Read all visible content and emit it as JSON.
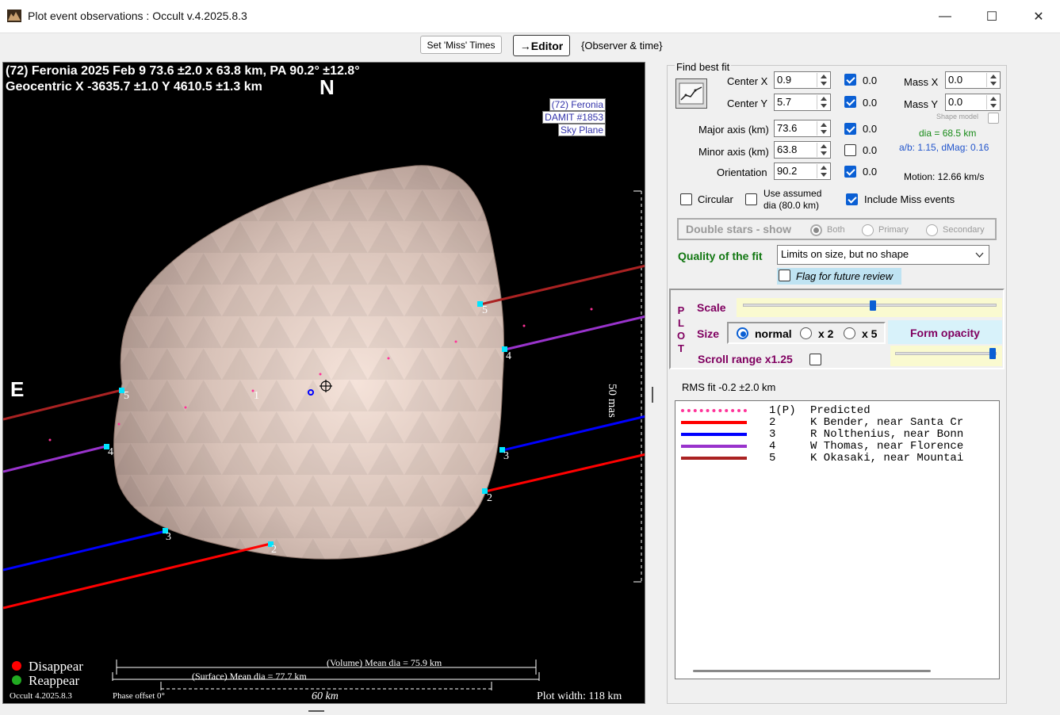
{
  "window": {
    "title": "Plot event observations : Occult v.4.2025.8.3",
    "minimize": "—",
    "maximize": "☐",
    "close": "✕"
  },
  "toolbar": {
    "set_miss_label": "Set 'Miss' Times",
    "editor_label": "→Editor",
    "observer_time_label": "{Observer & time}"
  },
  "plot": {
    "header_line1": "(72) Feronia  2025 Feb 9   73.6 ±2.0 x 63.8 km,  PA 90.2° ±12.8°",
    "header_line2": "Geocentric  X  -3635.7 ±1.0  Y 4610.5 ±1.3 km",
    "north": "N",
    "east": "E",
    "model_box": [
      "(72) Feronia",
      "DAMIT #1853",
      "Sky Plane"
    ],
    "scale_label": "50 mas",
    "legend": {
      "disappear": "Disappear",
      "reappear": "Reappear",
      "disappear_color": "#ff0000",
      "reappear_color": "#22aa22"
    },
    "volume_dia": "(Volume) Mean dia = 75.9 km",
    "surface_dia": "(Surface) Mean dia = 77.7 km",
    "phase_offset": "Phase offset 0°",
    "scale_bar": "60 km",
    "plot_width": "Plot width: 118 km",
    "version": "Occult 4.2025.8.3",
    "chord_labels": {
      "predicted": "1",
      "c2": "2",
      "c3": "3",
      "c4": "4",
      "c5": "5"
    }
  },
  "fit": {
    "group_title": "Find best fit",
    "center_x": {
      "label": "Center X",
      "value": "0.9",
      "checked": true,
      "delta": "0.0"
    },
    "center_y": {
      "label": "Center Y",
      "value": "5.7",
      "checked": true,
      "delta": "0.0"
    },
    "major_axis": {
      "label": "Major axis (km)",
      "value": "73.6",
      "checked": true,
      "delta": "0.0"
    },
    "minor_axis": {
      "label": "Minor axis (km)",
      "value": "63.8",
      "checked": false,
      "delta": "0.0"
    },
    "orientation": {
      "label": "Orientation",
      "value": "90.2",
      "checked": true,
      "delta": "0.0"
    },
    "mass_x": {
      "label": "Mass X",
      "value": "0.0"
    },
    "mass_y": {
      "label": "Mass Y",
      "value": "0.0"
    },
    "shape_model_label": "Shape model",
    "dia": "dia = 68.5 km",
    "ab": "a/b: 1.15, dMag: 0.16",
    "motion": "Motion: 12.66 km/s",
    "circular_label": "Circular",
    "use_assumed_label_1": "Use assumed",
    "use_assumed_label_2": "dia (80.0 km)",
    "include_miss_label": "Include Miss events",
    "double_stars_label": "Double stars - show",
    "both_label": "Both",
    "primary_label": "Primary",
    "secondary_label": "Secondary",
    "quality_label": "Quality of the fit",
    "quality_value": "Limits on size, but no shape",
    "flag_label": "Flag for future review"
  },
  "plot_opts": {
    "plot_letters": [
      "P",
      "L",
      "O",
      "T"
    ],
    "scale_label": "Scale",
    "size_label": "Size",
    "normal_label": "normal",
    "x2_label": "x 2",
    "x5_label": "x 5",
    "form_opacity_label": "Form opacity",
    "scroll_range_label": "Scroll range x1.25"
  },
  "rms": "RMS fit -0.2 ±2.0 km",
  "observers": [
    {
      "num": "1(P)",
      "name": "Predicted",
      "color": "#ff3399",
      "style": "dotted"
    },
    {
      "num": "2",
      "name": "K Bender, near Santa Cr",
      "color": "#ff0000",
      "style": "solid"
    },
    {
      "num": "3",
      "name": "R Nolthenius, near Bonn",
      "color": "#0000ff",
      "style": "solid"
    },
    {
      "num": "4",
      "name": "W Thomas, near Florence",
      "color": "#9933cc",
      "style": "solid"
    },
    {
      "num": "5",
      "name": "K Okasaki, near Mountai",
      "color": "#aa2222",
      "style": "solid"
    }
  ]
}
